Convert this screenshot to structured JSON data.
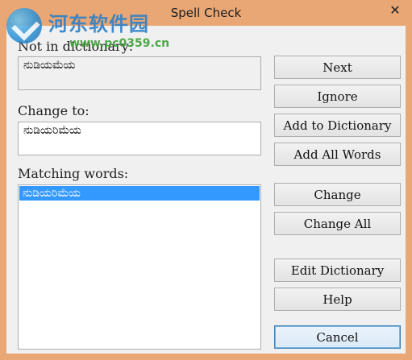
{
  "window": {
    "title": "Spell Check",
    "close_glyph": "✕"
  },
  "watermark": {
    "site_name": "河东软件园",
    "url": "www.pc0359.cn"
  },
  "not_in_dictionary": {
    "label": "Not in dictionary:",
    "value": "ನುಡಿಯಮೆಯ"
  },
  "change_to": {
    "label": "Change to:",
    "value": "ನುಡಿಯರಿಮೆಯ"
  },
  "matching_words": {
    "label": "Matching words:",
    "items": [
      "ನುಡಿಯರಿಮೆಯ"
    ],
    "selected_index": 0
  },
  "buttons": {
    "next": "Next",
    "ignore": "Ignore",
    "add_to_dictionary": "Add to Dictionary",
    "add_all_words": "Add All Words",
    "change": "Change",
    "change_all": "Change All",
    "edit_dictionary": "Edit Dictionary",
    "help": "Help",
    "cancel": "Cancel"
  },
  "colors": {
    "titlebar": "#e8a774",
    "client": "#f0f0f0",
    "selection": "#3399ff"
  }
}
